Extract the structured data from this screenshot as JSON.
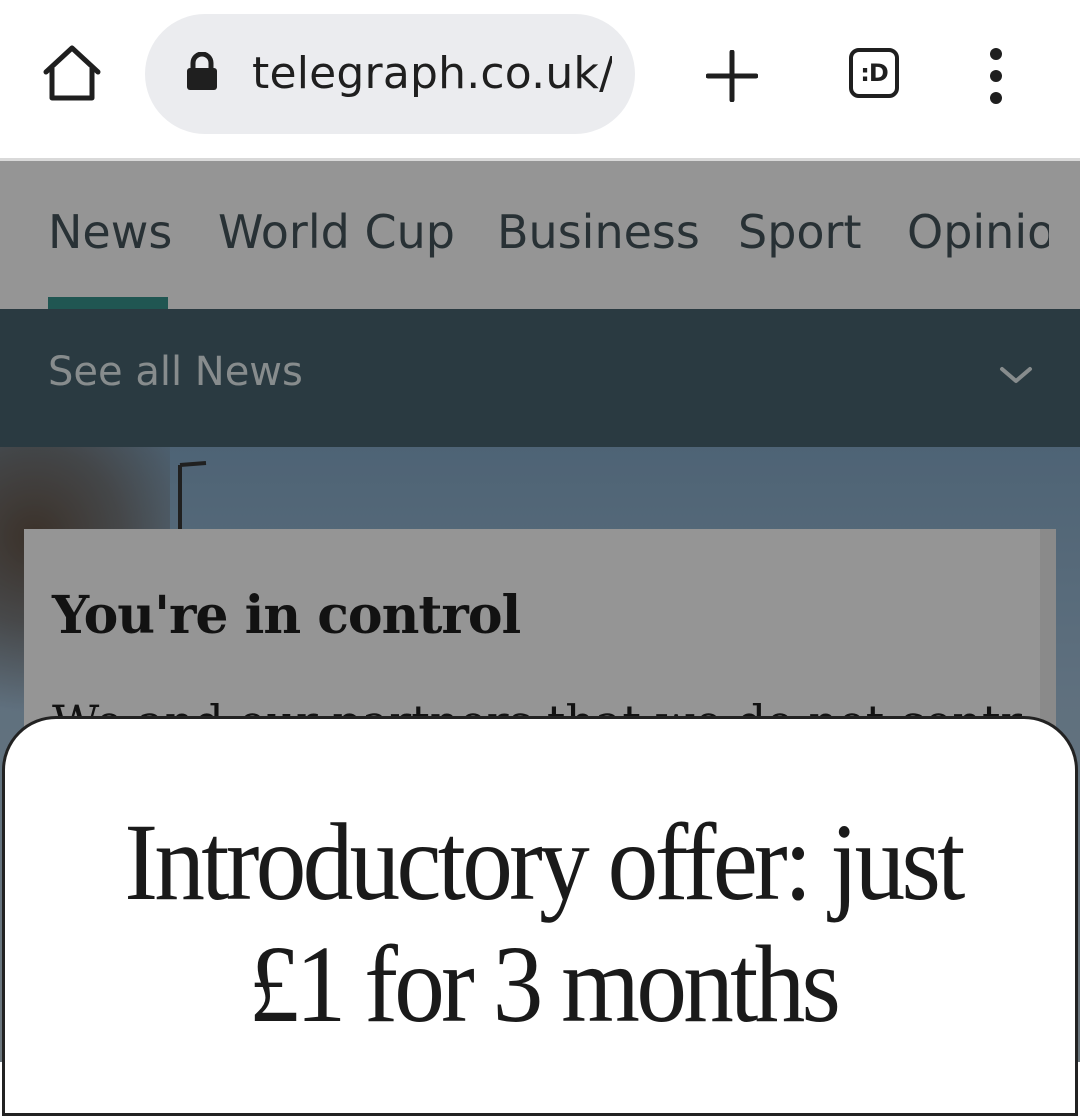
{
  "browser": {
    "url": "telegraph.co.uk/r",
    "tabs_label": ":D"
  },
  "nav": {
    "items": [
      "News",
      "World Cup",
      "Business",
      "Sport",
      "Opinio"
    ],
    "active_index": 0
  },
  "subnav": {
    "label": "See all News"
  },
  "consent": {
    "title": "You're in control",
    "body_partial": "We and our partners that we do not control"
  },
  "offer": {
    "headline_line1": "Introductory offer: just",
    "headline_line2": "£1 for 3 months"
  },
  "colors": {
    "accent_underline": "#2a8c86",
    "subnav_bg": "#3d5a66"
  }
}
